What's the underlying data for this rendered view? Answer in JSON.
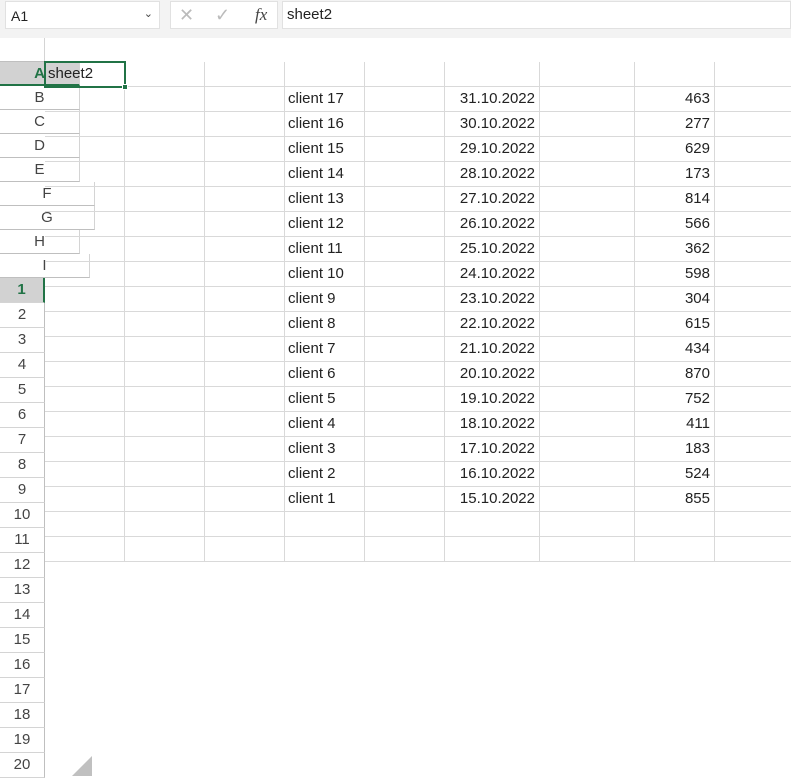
{
  "formula_bar": {
    "name_box": "A1",
    "formula": "sheet2",
    "cancel_icon": "✕",
    "enter_icon": "✓",
    "fx_label": "fx"
  },
  "columns": [
    "A",
    "B",
    "C",
    "D",
    "E",
    "F",
    "G",
    "H",
    "I"
  ],
  "row_count": 20,
  "selected_cell": "A1",
  "accent_color": "#217346",
  "cells": {
    "A1": "sheet2",
    "rows": [
      {
        "row": 2,
        "D": "client 17",
        "F": "31.10.2022",
        "H": "463"
      },
      {
        "row": 3,
        "D": "client 16",
        "F": "30.10.2022",
        "H": "277"
      },
      {
        "row": 4,
        "D": "client 15",
        "F": "29.10.2022",
        "H": "629"
      },
      {
        "row": 5,
        "D": "client 14",
        "F": "28.10.2022",
        "H": "173"
      },
      {
        "row": 6,
        "D": "client 13",
        "F": "27.10.2022",
        "H": "814"
      },
      {
        "row": 7,
        "D": "client 12",
        "F": "26.10.2022",
        "H": "566"
      },
      {
        "row": 8,
        "D": "client 11",
        "F": "25.10.2022",
        "H": "362"
      },
      {
        "row": 9,
        "D": "client 10",
        "F": "24.10.2022",
        "H": "598"
      },
      {
        "row": 10,
        "D": "client 9",
        "F": "23.10.2022",
        "H": "304"
      },
      {
        "row": 11,
        "D": "client 8",
        "F": "22.10.2022",
        "H": "615"
      },
      {
        "row": 12,
        "D": "client 7",
        "F": "21.10.2022",
        "H": "434"
      },
      {
        "row": 13,
        "D": "client 6",
        "F": "20.10.2022",
        "H": "870"
      },
      {
        "row": 14,
        "D": "client 5",
        "F": "19.10.2022",
        "H": "752"
      },
      {
        "row": 15,
        "D": "client 4",
        "F": "18.10.2022",
        "H": "411"
      },
      {
        "row": 16,
        "D": "client 3",
        "F": "17.10.2022",
        "H": "183"
      },
      {
        "row": 17,
        "D": "client 2",
        "F": "16.10.2022",
        "H": "524"
      },
      {
        "row": 18,
        "D": "client 1",
        "F": "15.10.2022",
        "H": "855"
      }
    ]
  }
}
